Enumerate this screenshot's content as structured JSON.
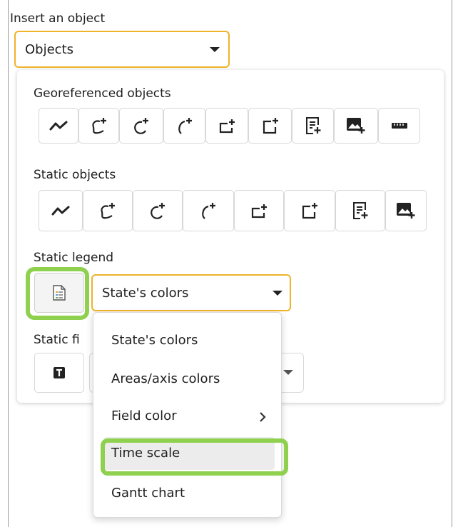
{
  "header": {
    "title": "Insert an object"
  },
  "object_type": {
    "value": "Objects",
    "icon": "chevron-down-icon"
  },
  "georeferenced": {
    "title": "Georeferenced objects",
    "tools": [
      "polyline-icon",
      "free-shape-add-icon",
      "circle-add-icon",
      "arc-add-icon",
      "rectangle-add-icon",
      "square-add-icon",
      "text-add-icon",
      "image-add-icon",
      "ruler-icon"
    ]
  },
  "static_objects": {
    "title": "Static objects",
    "tools": [
      "polyline-icon",
      "free-shape-add-icon",
      "circle-add-icon",
      "arc-add-icon",
      "rectangle-add-icon",
      "square-add-icon",
      "text-add-icon",
      "image-add-icon"
    ]
  },
  "static_legend": {
    "title": "Static legend",
    "icon": "legend-document-icon",
    "selected": "State's colors"
  },
  "static_field": {
    "title_visible": "Static fi",
    "icon": "text-box-icon"
  },
  "dropdown_menu": {
    "items": [
      "State's colors",
      "Areas/axis colors",
      "Field color",
      "Time scale",
      "Gantt chart"
    ],
    "submenu_icon": "chevron-right-icon",
    "highlighted": "Time scale"
  },
  "colors": {
    "accent_border": "#f0b32b",
    "highlight_ring": "#8fd14f",
    "menu_hover": "#ececec"
  }
}
